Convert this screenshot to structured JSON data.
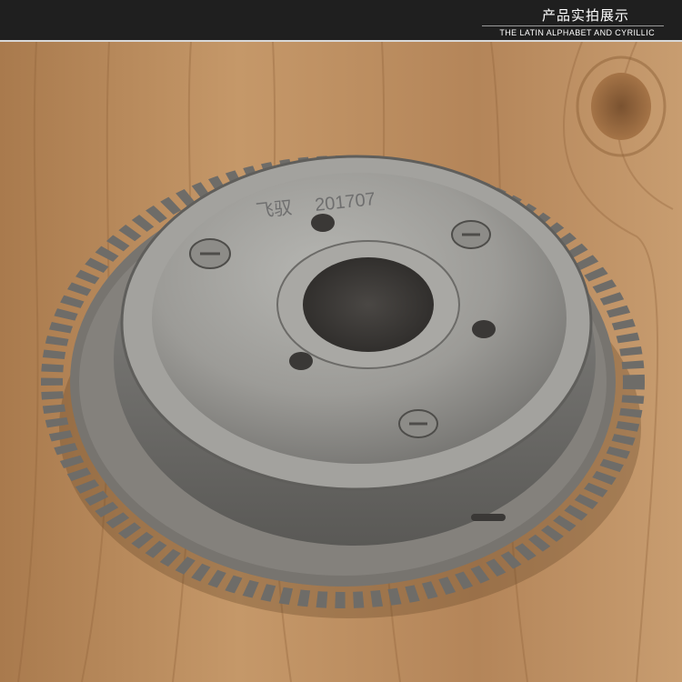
{
  "banner": {
    "title": "产品实拍展示",
    "subtitle": "THE LATIN ALPHABET AND CYRILLIC"
  },
  "product": {
    "engraving_logo": "飞驭",
    "engraving_code": "201707"
  },
  "colors": {
    "banner_bg": "#1f1f1f",
    "wood": "#b98a5b",
    "metal": "#8f8f8f"
  }
}
